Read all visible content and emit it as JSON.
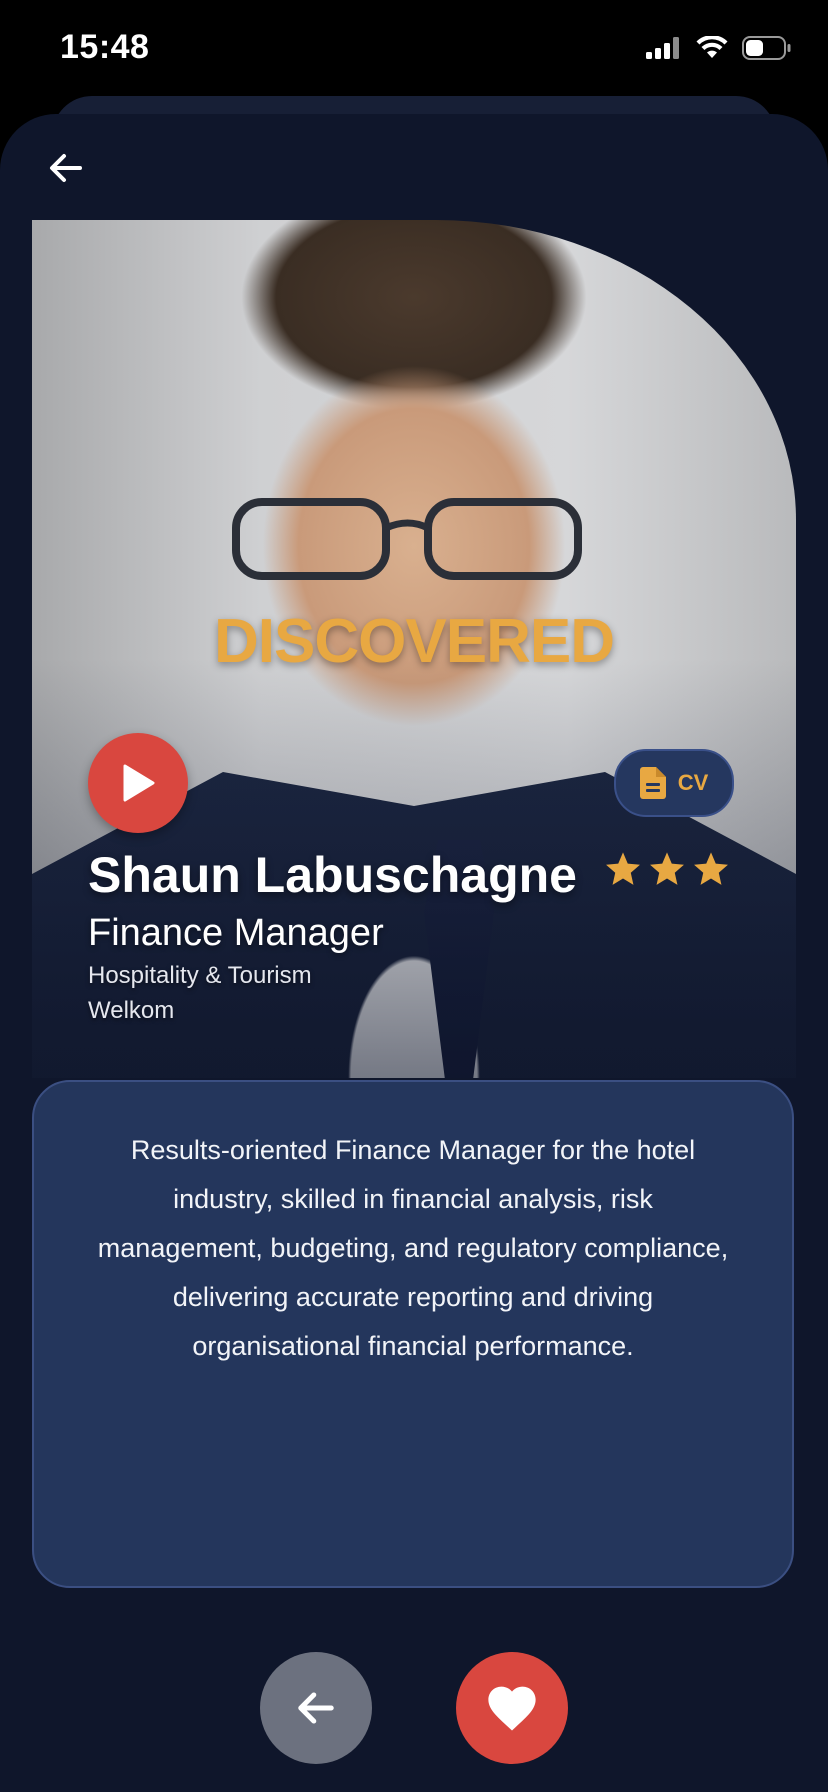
{
  "status_bar": {
    "time": "15:48"
  },
  "profile": {
    "badge": "DISCOVERED",
    "cv_label": "CV",
    "name": "Shaun Labuschagne",
    "job_title": "Finance Manager",
    "industry": "Hospitality & Tourism",
    "location": "Welkom",
    "rating": 3,
    "bio": "Results-oriented Finance Manager for the hotel industry, skilled in financial analysis, risk management, budgeting, and regulatory compliance, delivering accurate reporting and driving organisational financial performance."
  },
  "colors": {
    "accent": "#e8a842",
    "danger": "#d9473f",
    "card": "#24365c",
    "background": "#0f162b"
  },
  "icons": [
    "back-arrow-icon",
    "play-icon",
    "document-icon",
    "star-icon",
    "heart-icon",
    "signal-icon",
    "wifi-icon",
    "battery-icon"
  ]
}
